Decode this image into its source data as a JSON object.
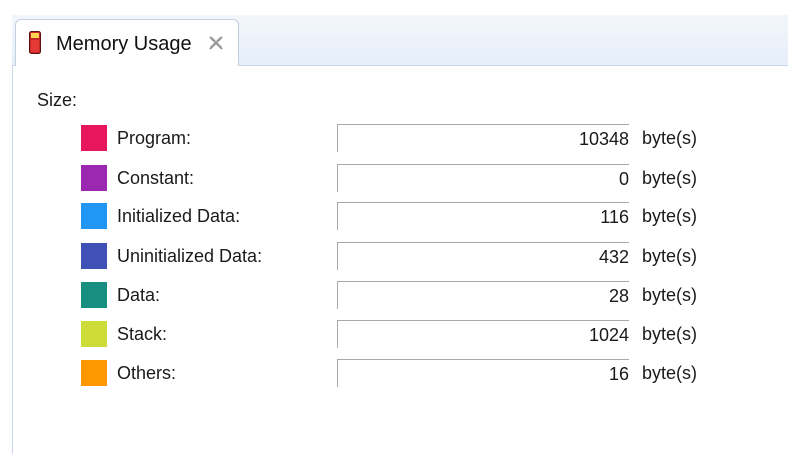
{
  "tab": {
    "title": "Memory Usage",
    "icon": "memory-icon",
    "close_icon": "close-icon"
  },
  "size_label": "Size:",
  "unit": "byte(s)",
  "rows": [
    {
      "label": "Program:",
      "value": "10348",
      "color": "#e8175d"
    },
    {
      "label": "Constant:",
      "value": "0",
      "color": "#9c27b0"
    },
    {
      "label": "Initialized Data:",
      "value": "116",
      "color": "#2196f3"
    },
    {
      "label": "Uninitialized Data:",
      "value": "432",
      "color": "#3f51b5"
    },
    {
      "label": "Data:",
      "value": "28",
      "color": "#168f80"
    },
    {
      "label": "Stack:",
      "value": "1024",
      "color": "#cddc39"
    },
    {
      "label": "Others:",
      "value": "16",
      "color": "#ff9800"
    }
  ]
}
